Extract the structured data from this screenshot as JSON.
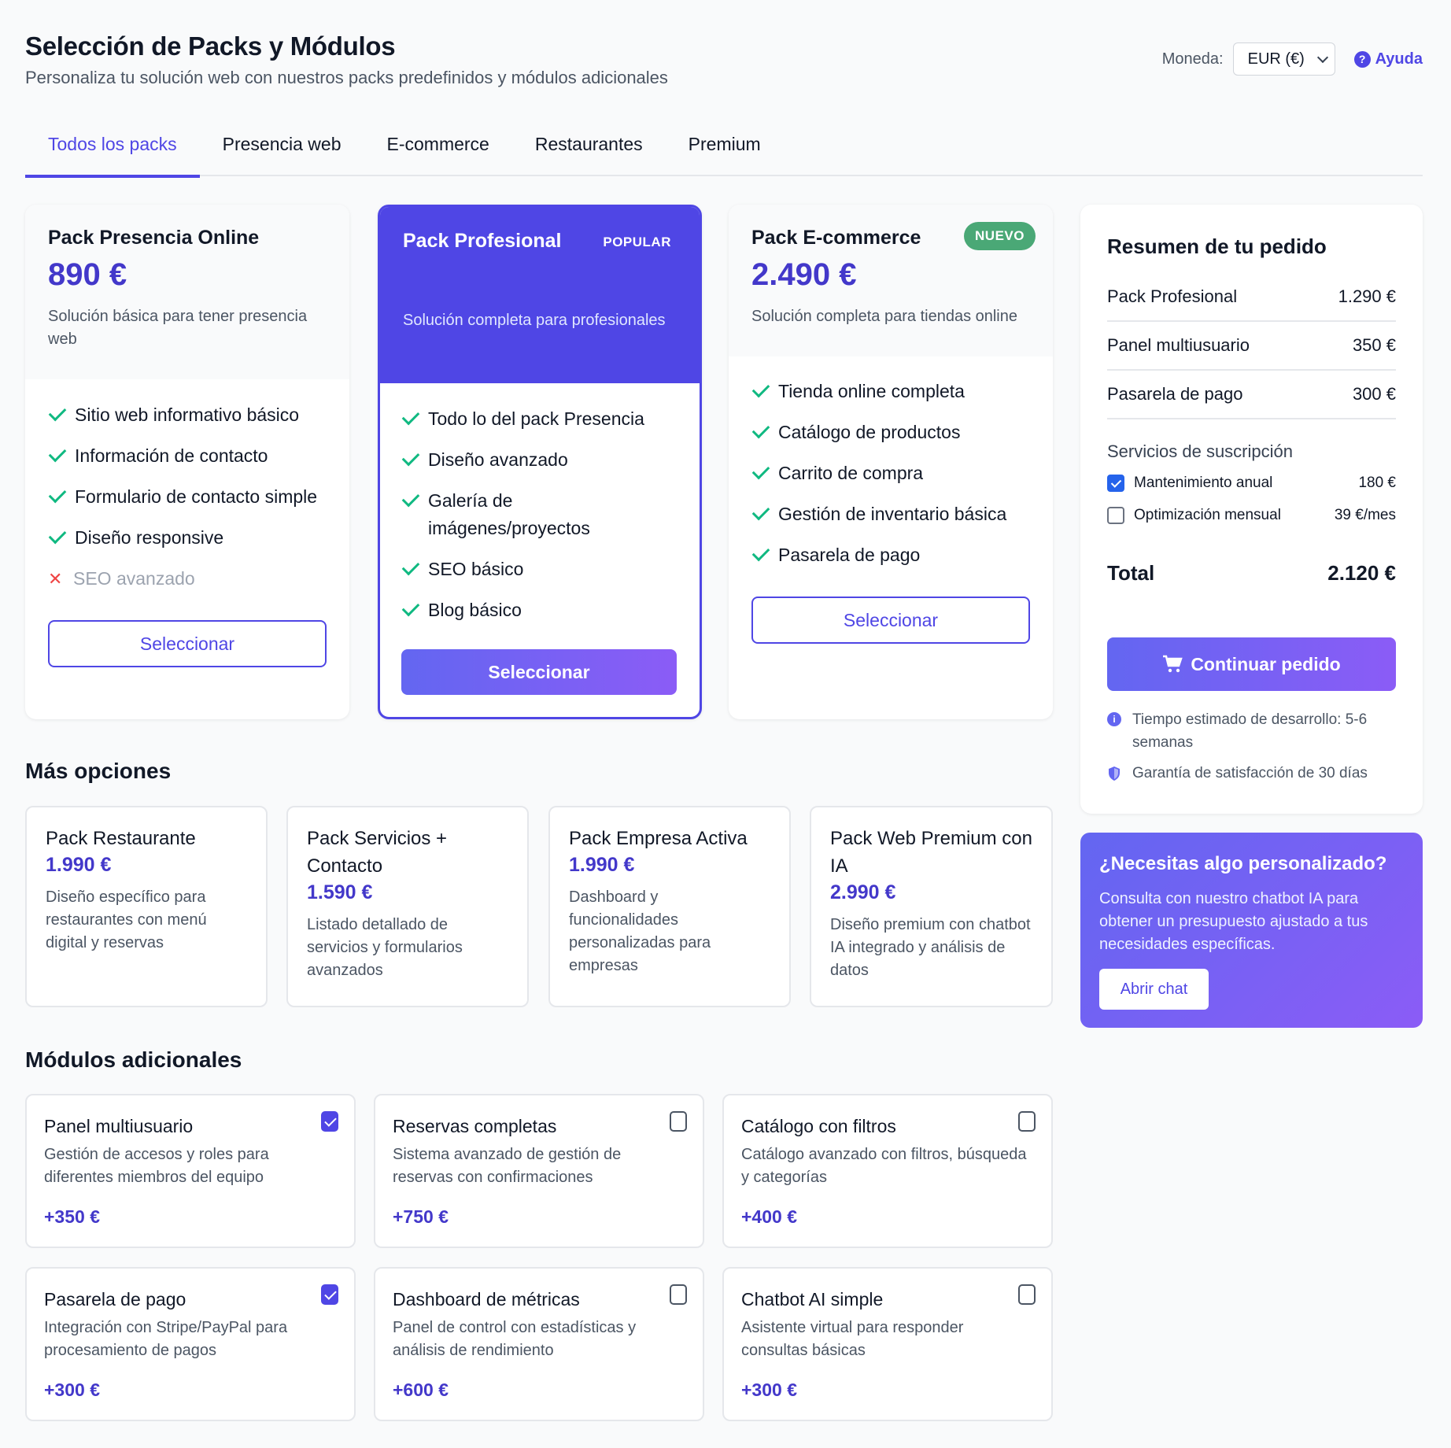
{
  "header": {
    "title": "Selección de Packs y Módulos",
    "subtitle": "Personaliza tu solución web con nuestros packs predefinidos y módulos adicionales",
    "currency_label": "Moneda:",
    "currency_value": "EUR (€)",
    "help_icon": "question-circle-icon",
    "help_label": "Ayuda"
  },
  "tabs": [
    "Todos los packs",
    "Presencia web",
    "E-commerce",
    "Restaurantes",
    "Premium"
  ],
  "packs": [
    {
      "name": "Pack Presencia Online",
      "price": "890 €",
      "desc": "Solución básica para tener presencia web",
      "features": [
        "Sitio web informativo básico",
        "Información de contacto",
        "Formulario de contacto simple",
        "Diseño responsive"
      ],
      "excluded": "SEO avanzado",
      "button": "Seleccionar"
    },
    {
      "name": "Pack Profesional",
      "badge": "POPULAR",
      "desc": "Solución completa para profesionales",
      "features": [
        "Todo lo del pack Presencia",
        "Diseño avanzado",
        "Galería de imágenes/proyectos",
        "SEO básico",
        "Blog básico"
      ],
      "button": "Seleccionar"
    },
    {
      "name": "Pack E-commerce",
      "badge": "NUEVO",
      "price": "2.490 €",
      "desc": "Solución completa para tiendas online",
      "features": [
        "Tienda online completa",
        "Catálogo de productos",
        "Carrito de compra",
        "Gestión de inventario básica",
        "Pasarela de pago"
      ],
      "button": "Seleccionar"
    }
  ],
  "more_options": {
    "title": "Más opciones",
    "items": [
      {
        "name": "Pack Restaurante",
        "price": "1.990 €",
        "desc": "Diseño específico para restaurantes con menú digital y reservas"
      },
      {
        "name": "Pack Servicios + Contacto",
        "price": "1.590 €",
        "desc": "Listado detallado de servicios y formularios avanzados"
      },
      {
        "name": "Pack Empresa Activa",
        "price": "1.990 €",
        "desc": "Dashboard y funcionalidades personalizadas para empresas"
      },
      {
        "name": "Pack Web Premium con IA",
        "price": "2.990 €",
        "desc": "Diseño premium con chatbot IA integrado y análisis de datos"
      }
    ]
  },
  "modules": {
    "title": "Módulos adicionales",
    "items": [
      {
        "name": "Panel multiusuario",
        "desc": "Gestión de accesos y roles para diferentes miembros del equipo",
        "price": "+350 €",
        "checked": true
      },
      {
        "name": "Reservas completas",
        "desc": "Sistema avanzado de gestión de reservas con confirmaciones",
        "price": "+750 €",
        "checked": false
      },
      {
        "name": "Catálogo con filtros",
        "desc": "Catálogo avanzado con filtros, búsqueda y categorías",
        "price": "+400 €",
        "checked": false
      },
      {
        "name": "Pasarela de pago",
        "desc": "Integración con Stripe/PayPal para procesamiento de pagos",
        "price": "+300 €",
        "checked": true
      },
      {
        "name": "Dashboard de métricas",
        "desc": "Panel de control con estadísticas y análisis de rendimiento",
        "price": "+600 €",
        "checked": false
      },
      {
        "name": "Chatbot AI simple",
        "desc": "Asistente virtual para responder consultas básicas",
        "price": "+300 €",
        "checked": false
      }
    ]
  },
  "summary": {
    "title": "Resumen de tu pedido",
    "rows": [
      {
        "label": "Pack Profesional",
        "value": "1.290 €"
      },
      {
        "label": "Panel multiusuario",
        "value": "350 €"
      },
      {
        "label": "Pasarela de pago",
        "value": "300 €"
      }
    ],
    "subs_title": "Servicios de suscripción",
    "subs": [
      {
        "label": "Mantenimiento anual",
        "value": "180 €",
        "checked": true
      },
      {
        "label": "Optimización mensual",
        "value": "39 €/mes",
        "checked": false
      }
    ],
    "total_label": "Total",
    "total_value": "2.120 €",
    "cta": "Continuar pedido",
    "cta_icon": "cart-icon",
    "info1": "Tiempo estimado de desarrollo: 5-6 semanas",
    "info2": "Garantía de satisfacción de 30 días"
  },
  "custom": {
    "title": "¿Necesitas algo personalizado?",
    "text": "Consulta con nuestro chatbot IA para obtener un presupuesto ajustado a tus necesidades específicas.",
    "button": "Abrir chat"
  },
  "colors": {
    "accent": "#4f46e5",
    "check": "#10b981",
    "cross": "#ef4444"
  }
}
